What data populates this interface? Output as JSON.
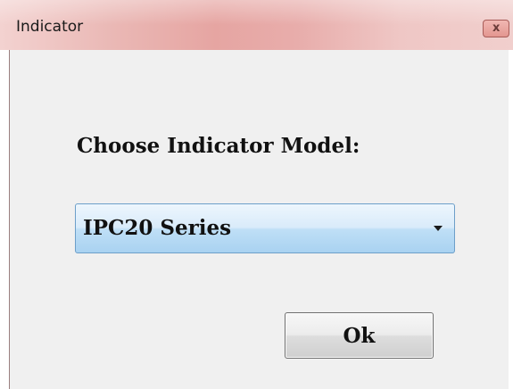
{
  "window": {
    "title": "Indicator"
  },
  "form": {
    "prompt": "Choose Indicator Model:",
    "selected_model": "IPC20 Series"
  },
  "buttons": {
    "ok": "Ok"
  },
  "icons": {
    "close": "close-icon",
    "dropdown": "chevron-down-icon"
  },
  "colors": {
    "titlebar": "#e8adab",
    "dialog_background": "#f0f0f0",
    "select_border": "#6d9fc9",
    "select_highlight": "#bfdff6",
    "text": "#111111"
  }
}
